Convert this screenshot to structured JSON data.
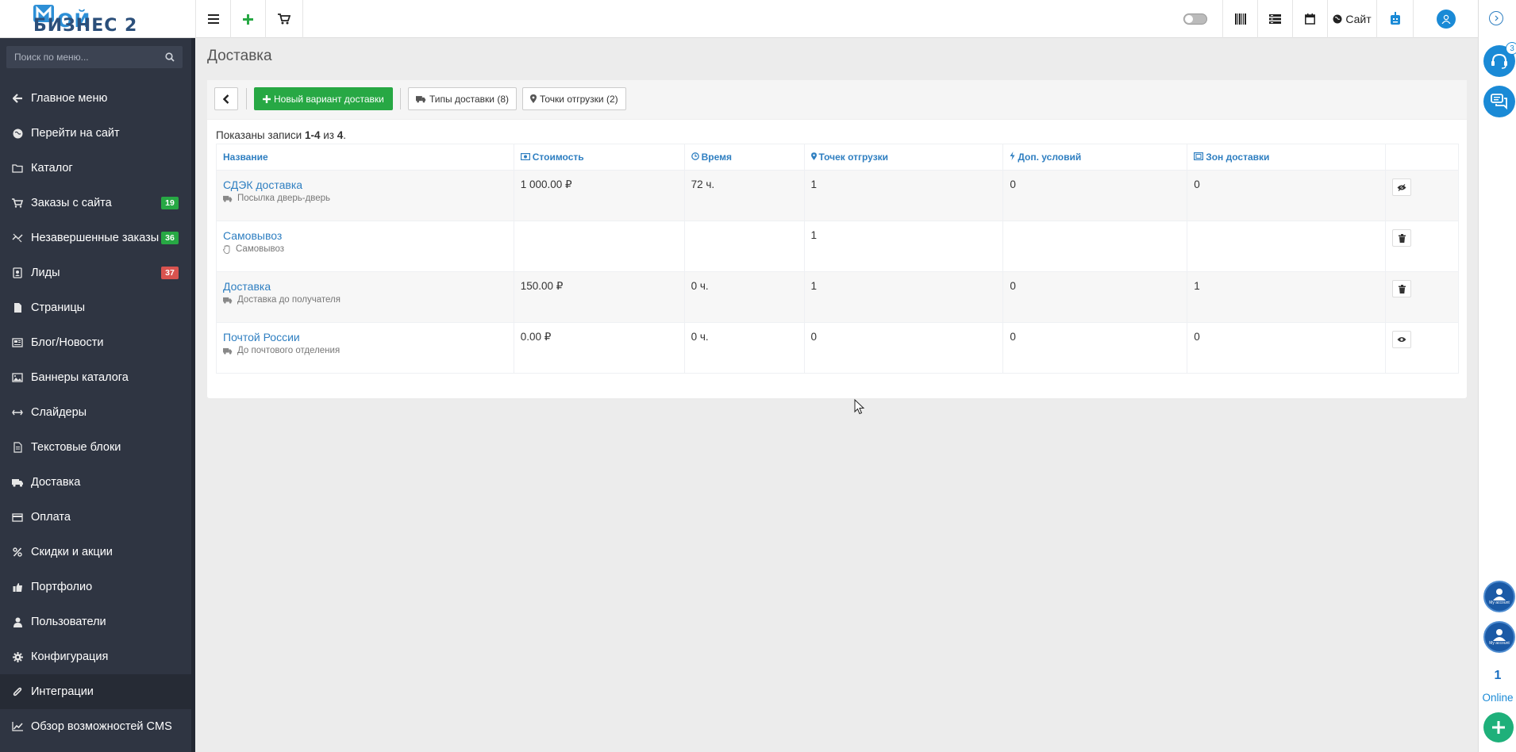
{
  "brand": {
    "logo_line1": "ОЙ",
    "logo_line2": "БИЗНЕС 2",
    "accent": "#27a844",
    "link": "#2f7fc1",
    "sidebar_bg": "#2f3542"
  },
  "topbar": {
    "site_label": "Сайт",
    "icons": [
      "menu-icon",
      "plus-icon",
      "cart-icon",
      "toggle-switch",
      "barcode-icon",
      "list-icon",
      "calendar-icon",
      "globe-icon",
      "robot-icon",
      "user-icon"
    ]
  },
  "sidebar": {
    "search_placeholder": "Поиск по меню...",
    "items": [
      {
        "label": "Главное меню",
        "icon": "arrow-left-icon"
      },
      {
        "label": "Перейти на сайт",
        "icon": "globe-icon"
      },
      {
        "label": "Каталог",
        "icon": "folder-icon"
      },
      {
        "label": "Заказы с сайта",
        "icon": "cart-icon",
        "badge": "19"
      },
      {
        "label": "Незавершенные заказы",
        "icon": "pulse-icon",
        "badge": "36"
      },
      {
        "label": "Лиды",
        "icon": "contacts-icon",
        "badge": "37"
      },
      {
        "label": "Страницы",
        "icon": "file-icon"
      },
      {
        "label": "Блог/Новости",
        "icon": "newspaper-icon"
      },
      {
        "label": "Баннеры каталога",
        "icon": "image-icon"
      },
      {
        "label": "Слайдеры",
        "icon": "arrows-h-icon"
      },
      {
        "label": "Текстовые блоки",
        "icon": "text-file-icon"
      },
      {
        "label": "Доставка",
        "icon": "truck-icon"
      },
      {
        "label": "Оплата",
        "icon": "credit-card-icon"
      },
      {
        "label": "Скидки и акции",
        "icon": "percent-icon"
      },
      {
        "label": "Портфолио",
        "icon": "thumbs-up-icon"
      },
      {
        "label": "Пользователи",
        "icon": "user-icon"
      },
      {
        "label": "Конфигурация",
        "icon": "gear-icon"
      },
      {
        "label": "Интеграции",
        "icon": "paperclip-icon"
      },
      {
        "label": "Обзор возможностей CMS",
        "icon": "chart-line-icon"
      }
    ]
  },
  "page": {
    "title": "Доставка",
    "new_button": "Новый вариант доставки",
    "types_button": "Типы доставки (8)",
    "points_button": "Точки отгрузки (2)",
    "summary_prefix": "Показаны записи ",
    "summary_range": "1-4",
    "summary_mid": " из ",
    "summary_total": "4",
    "summary_end": "."
  },
  "table": {
    "columns": [
      "Название",
      "Стоимость",
      "Время",
      "Точек отгрузки",
      "Доп. условий",
      "Зон доставки"
    ],
    "rows": [
      {
        "name": "СДЭК доставка",
        "sub": "Посылка дверь-дверь",
        "sub_icon": "truck-icon",
        "cost": "1 000.00 ₽",
        "time": "72 ч.",
        "points": "1",
        "extra": "0",
        "zones": "0",
        "action": "eye-slash-icon"
      },
      {
        "name": "Самовывоз",
        "sub": "Самовывоз",
        "sub_icon": "hand-icon",
        "cost": "",
        "time": "",
        "points": "1",
        "extra": "",
        "zones": "",
        "action": "trash-icon"
      },
      {
        "name": "Доставка",
        "sub": "Доставка до получателя",
        "sub_icon": "truck-icon",
        "cost": "150.00 ₽",
        "time": "0 ч.",
        "points": "1",
        "extra": "0",
        "zones": "1",
        "action": "trash-icon"
      },
      {
        "name": "Почтой России",
        "sub": "До почтового отделения",
        "sub_icon": "truck-icon",
        "cost": "0.00 ₽",
        "time": "0 ч.",
        "points": "0",
        "extra": "0",
        "zones": "0",
        "action": "eye-icon"
      }
    ]
  },
  "rail": {
    "notification_count": "3",
    "avatar_caption": "My account",
    "online_count": "1",
    "online_label": "Online"
  }
}
